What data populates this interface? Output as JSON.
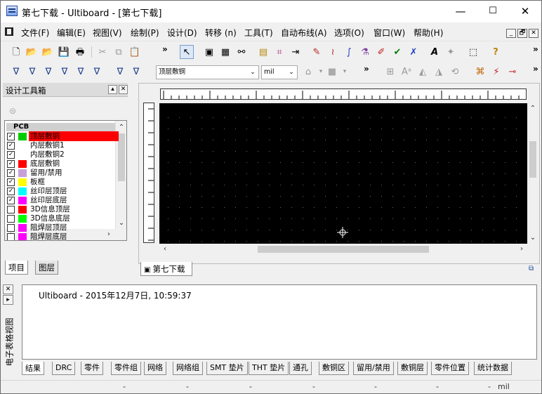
{
  "window": {
    "title": "第七下载 - Ultiboard - [第七下载]",
    "minimize": "—",
    "maximize": "☐",
    "close": "✕"
  },
  "menu": {
    "items": [
      "文件(F)",
      "编辑(E)",
      "视图(V)",
      "绘制(P)",
      "设计(D)",
      "转移 (n)",
      "工具(T)",
      "自动布线(A)",
      "选项(O)",
      "窗口(W)",
      "帮助(H)"
    ],
    "mdi_min": "_",
    "mdi_restore": "🗗",
    "mdi_close": "✕"
  },
  "toolbar": {
    "layer_select": "顶层敷铜",
    "unit_select": "mil"
  },
  "design_toolbox": {
    "title": "设计工具箱",
    "group": "PCB",
    "layers": [
      {
        "name": "顶层敷铜",
        "checked": true,
        "color": "#00cc00",
        "selected": true
      },
      {
        "name": "内层敷铜1",
        "checked": true,
        "color": "#ffffff",
        "selected": false
      },
      {
        "name": "内层敷铜2",
        "checked": true,
        "color": "#ffffff",
        "selected": false
      },
      {
        "name": "底层敷铜",
        "checked": true,
        "color": "#ff0000",
        "selected": false
      },
      {
        "name": "留用/禁用",
        "checked": true,
        "color": "#c8a0d8",
        "selected": false
      },
      {
        "name": "板框",
        "checked": true,
        "color": "#ffff00",
        "selected": false
      },
      {
        "name": "丝印层顶层",
        "checked": true,
        "color": "#00ffff",
        "selected": false
      },
      {
        "name": "丝印层底层",
        "checked": true,
        "color": "#ff00ff",
        "selected": false
      },
      {
        "name": "3D信息顶层",
        "checked": false,
        "color": "#ff0000",
        "selected": false
      },
      {
        "name": "3D信息底层",
        "checked": false,
        "color": "#00ff00",
        "selected": false
      },
      {
        "name": "阻焊层顶层",
        "checked": false,
        "color": "#ff00ff",
        "selected": false
      },
      {
        "name": "阻焊层底层",
        "checked": false,
        "color": "#ff00ff",
        "selected": false
      }
    ],
    "tabs": [
      "项目",
      "图层"
    ],
    "active_tab": "项目"
  },
  "document": {
    "tab_label": "第七下载"
  },
  "output": {
    "side_label": "电子表格视图",
    "log_line": "Ultiboard  -  2015年12月7日, 10:59:37",
    "tabs": [
      "结果",
      "DRC",
      "零件",
      "零件组",
      "网络",
      "网络组",
      "SMT 垫片",
      "THT 垫片",
      "通孔",
      "敷铜区",
      "留用/禁用",
      "敷铜层",
      "零件位置",
      "统计数据"
    ],
    "active_tab": "结果"
  },
  "status": {
    "fields": [
      "-",
      "-",
      "-",
      "-",
      "-",
      "-",
      "-"
    ],
    "unit": "mil"
  },
  "colors": {
    "canvas": "#000000",
    "selected_layer": "#ff0000"
  }
}
